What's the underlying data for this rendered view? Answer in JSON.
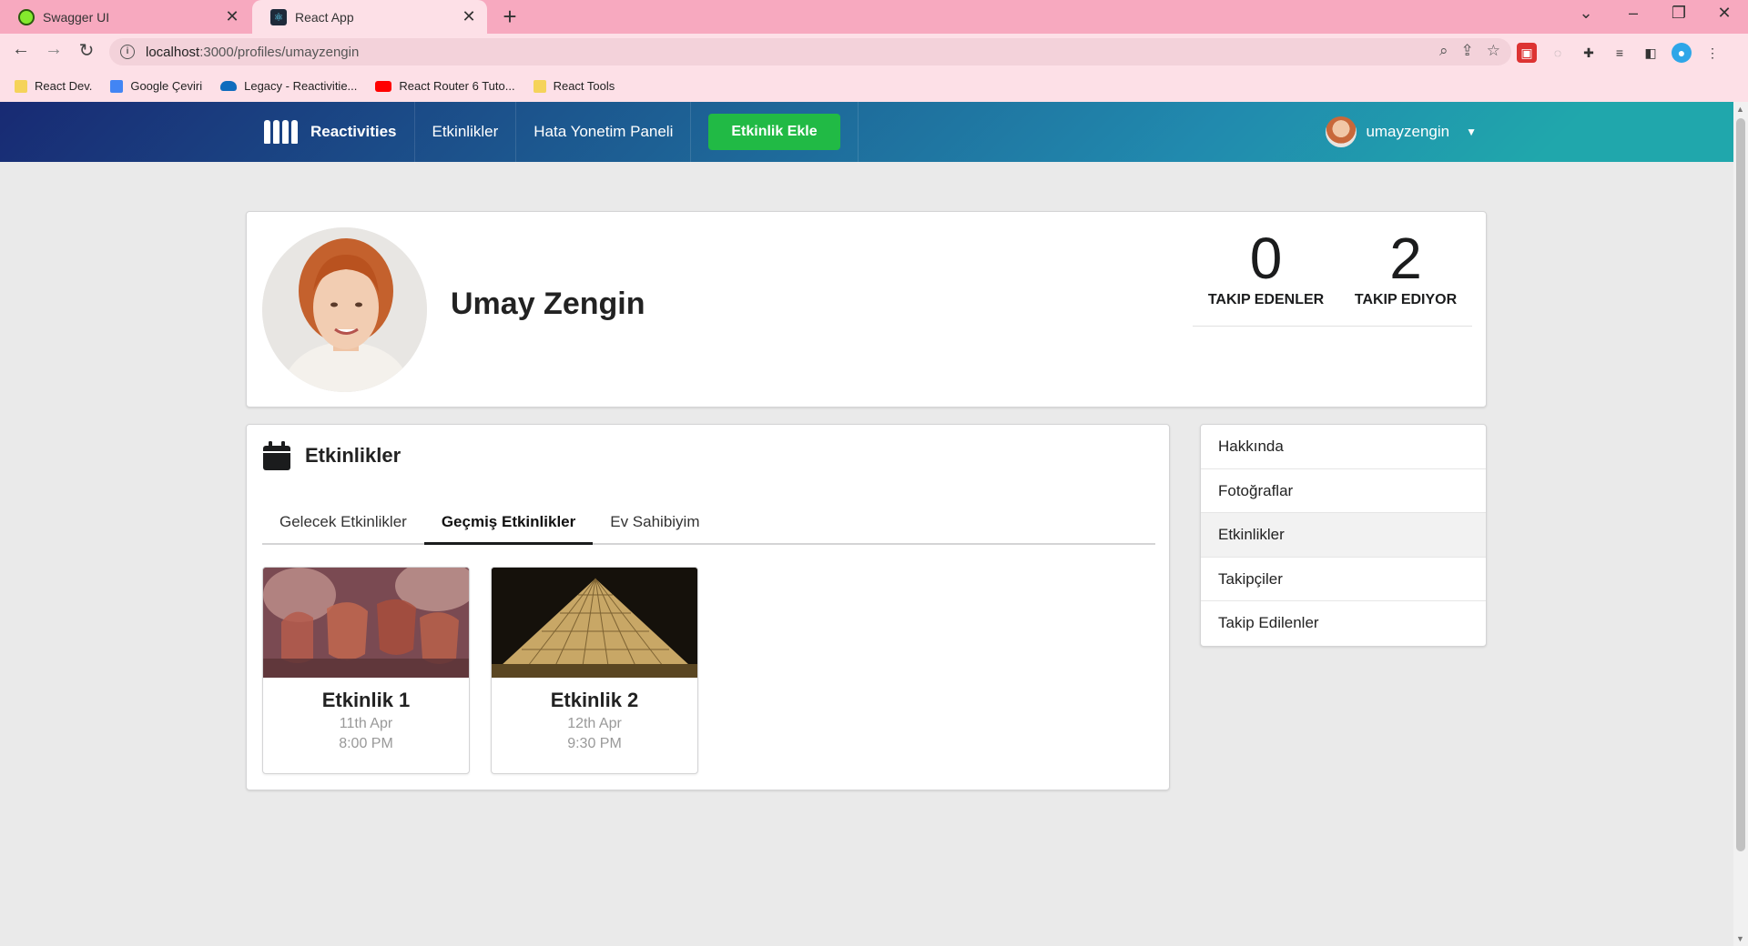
{
  "browser": {
    "tabs": [
      {
        "title": "Swagger UI",
        "active": false
      },
      {
        "title": "React App",
        "active": true
      }
    ],
    "url_host": "localhost",
    "url_path": ":3000/profiles/umayzengin",
    "bookmarks": [
      {
        "label": "React Dev.",
        "icon": "folder-icon",
        "color": "#f5d35a"
      },
      {
        "label": "Google Çeviri",
        "icon": "google-translate-icon",
        "color": "#4285f4"
      },
      {
        "label": "Legacy - Reactivitie...",
        "icon": "onedrive-icon",
        "color": "#0f6cbd"
      },
      {
        "label": "React Router 6 Tuto...",
        "icon": "youtube-icon",
        "color": "#ff0000"
      },
      {
        "label": "React Tools",
        "icon": "folder-icon",
        "color": "#f5d35a"
      }
    ]
  },
  "nav": {
    "brand": "Reactivities",
    "items": [
      "Etkinlikler",
      "Hata Yonetim Paneli"
    ],
    "add_button": "Etkinlik Ekle",
    "username": "umayzengin"
  },
  "profile": {
    "name": "Umay Zengin",
    "followers": {
      "value": "0",
      "label": "TAKIP EDENLER"
    },
    "following": {
      "value": "2",
      "label": "TAKIP EDIYOR"
    }
  },
  "activities": {
    "title": "Etkinlikler",
    "tabs": [
      "Gelecek Etkinlikler",
      "Geçmiş Etkinlikler",
      "Ev Sahibiyim"
    ],
    "active_tab": 1,
    "events": [
      {
        "title": "Etkinlik 1",
        "date": "11th Apr",
        "time": "8:00 PM",
        "image": "drinks"
      },
      {
        "title": "Etkinlik 2",
        "date": "12th Apr",
        "time": "9:30 PM",
        "image": "pyramid"
      }
    ]
  },
  "side_menu": {
    "items": [
      "Hakkında",
      "Fotoğraflar",
      "Etkinlikler",
      "Takipçiler",
      "Takip Edilenler"
    ],
    "active_index": 2
  },
  "colors": {
    "tabstrip": "#f7a9bf",
    "toolbar": "#fde0e7",
    "nav_gradient_start": "#182a73",
    "nav_gradient_end": "#20a7ac",
    "add_button": "#21ba45"
  }
}
